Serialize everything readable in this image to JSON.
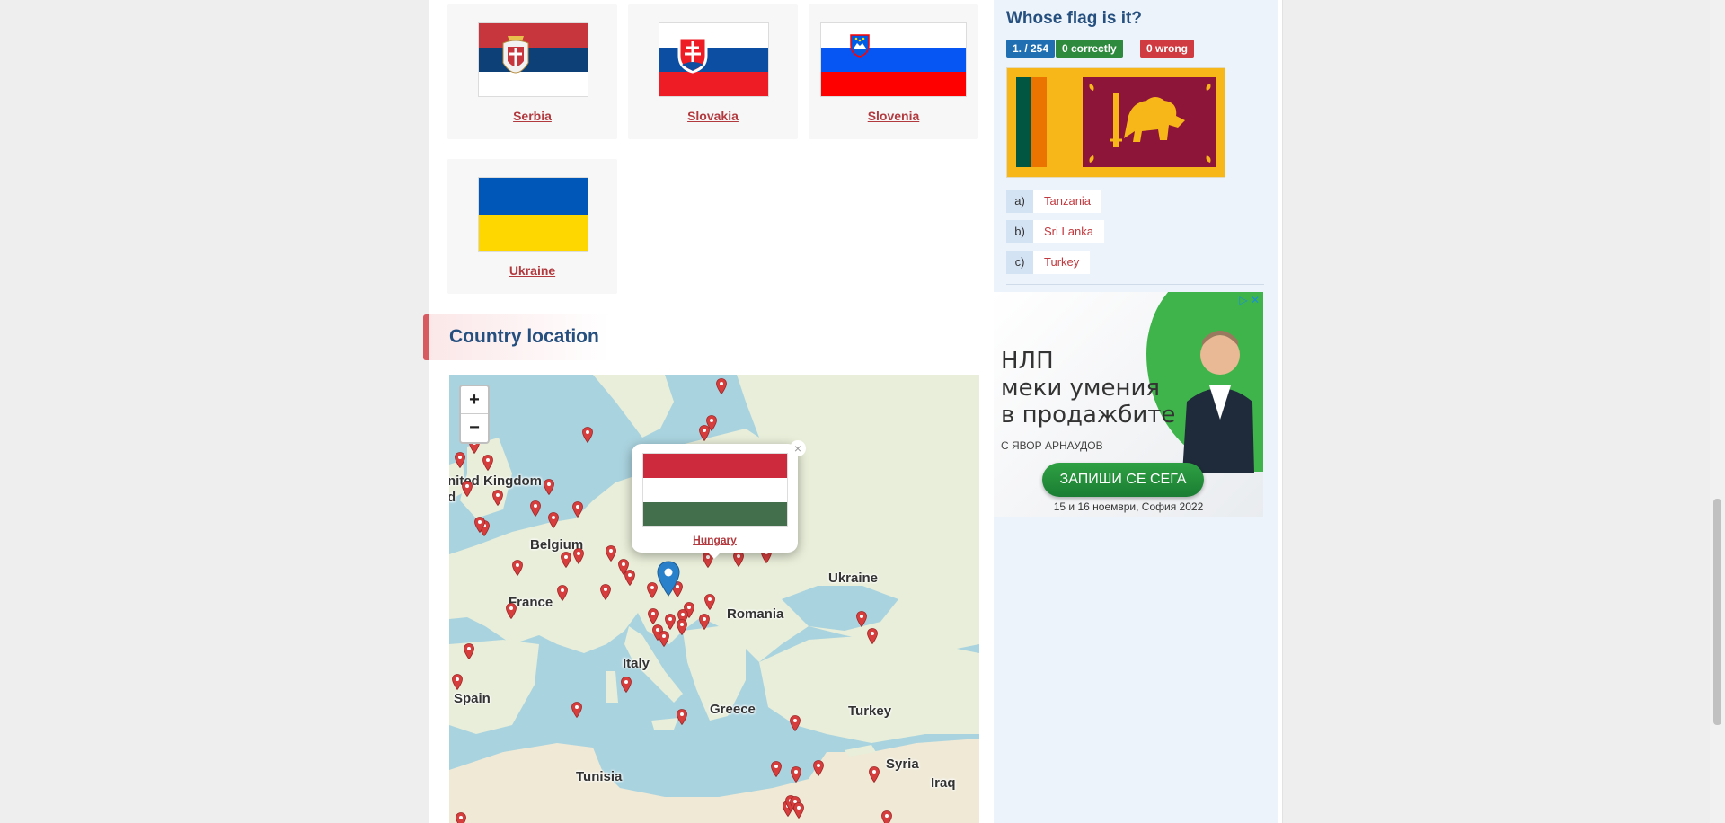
{
  "flags": [
    {
      "name": "Serbia"
    },
    {
      "name": "Slovakia"
    },
    {
      "name": "Slovenia"
    },
    {
      "name": "Ukraine"
    }
  ],
  "section": {
    "title": "Country location"
  },
  "map": {
    "zoom_in": "+",
    "zoom_out": "−",
    "labels": [
      "nited Kingdom",
      "d",
      "Belgium",
      "France",
      "Spain",
      "Italy",
      "Romania",
      "Ukraine",
      "Greece",
      "Turkey",
      "Tunisia",
      "Syria",
      "Iraq"
    ],
    "popup": {
      "country": "Hungary",
      "close": "×"
    }
  },
  "quiz": {
    "title": "Whose flag is it?",
    "progress": "1. / 254",
    "correct": "0 correctly",
    "wrong": "0 wrong",
    "answers": [
      {
        "letter": "a)",
        "text": "Tanzania"
      },
      {
        "letter": "b)",
        "text": "Sri Lanka"
      },
      {
        "letter": "c)",
        "text": "Turkey"
      }
    ]
  },
  "ad": {
    "line1": "НЛП",
    "line2": "меки умения",
    "line3": "в продажбите",
    "sub": "С ЯВОР АРНАУДОВ",
    "cta": "ЗАПИШИ СЕ СЕГА",
    "date": "15 и 16 ноември, София 2022",
    "adchoices": "▷ ✕"
  },
  "colors": {
    "link": "#b23a3f",
    "heading": "#254f7e",
    "badge_progress": "#1f6fb2",
    "badge_correct": "#2e8b3e",
    "badge_wrong": "#cf3b40"
  }
}
